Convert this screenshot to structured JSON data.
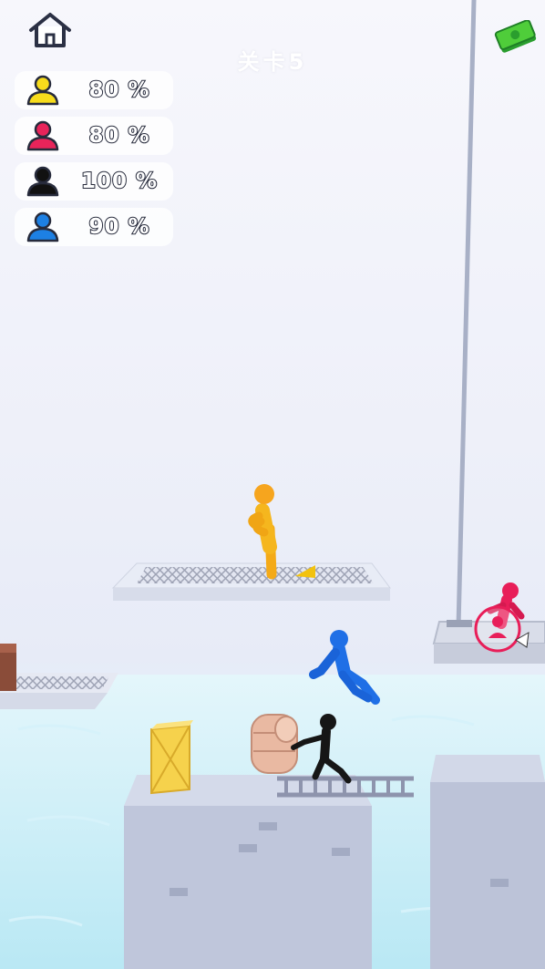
{
  "level": {
    "title": "关卡5"
  },
  "icons": {
    "home": "home-icon",
    "cash": "cash-icon",
    "player": "person-icon",
    "next": "target-arrow-icon"
  },
  "rankings": [
    {
      "player": "yellow",
      "color": "#f7dc1c",
      "percent": "80 %"
    },
    {
      "player": "red",
      "color": "#e8245a",
      "percent": "80 %"
    },
    {
      "player": "black",
      "color": "#111111",
      "percent": "100 %"
    },
    {
      "player": "blue",
      "color": "#1d80e3",
      "percent": "90 %"
    }
  ],
  "characters": [
    {
      "name": "yellow-stickman",
      "color": "#f5b41c"
    },
    {
      "name": "blue-stickman",
      "color": "#1f6fe6"
    },
    {
      "name": "black-stickman",
      "color": "#161616"
    },
    {
      "name": "red-stickman",
      "color": "#e81e59"
    }
  ]
}
